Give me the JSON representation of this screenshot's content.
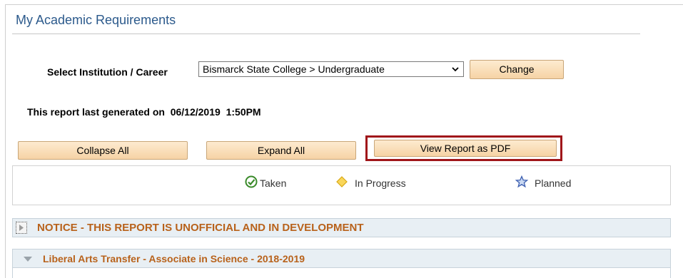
{
  "page": {
    "title": "My Academic Requirements"
  },
  "selector": {
    "label": "Select Institution / Career",
    "selected_value": "Bismarck State College > Undergraduate",
    "change_label": "Change"
  },
  "report": {
    "generated_label": "This report last generated on",
    "generated_date": "06/12/2019",
    "generated_time": "1:50PM"
  },
  "actions": {
    "collapse_label": "Collapse All",
    "expand_label": "Expand All",
    "pdf_label": "View Report as PDF",
    "highlight_color": "#a0161a"
  },
  "legend": {
    "taken": {
      "label": "Taken",
      "icon": "check-circle-icon",
      "color": "#3a8a2a"
    },
    "in_progress": {
      "label": "In Progress",
      "icon": "diamond-icon",
      "color": "#f2c230"
    },
    "planned": {
      "label": "Planned",
      "icon": "star-icon",
      "color": "#3d5fb0"
    }
  },
  "sections": [
    {
      "title": "NOTICE - THIS REPORT IS UNOFFICIAL AND IN DEVELOPMENT",
      "state": "collapsed",
      "icon": "expand-arrow-icon"
    },
    {
      "title": "Liberal Arts Transfer - Associate in Science - 2018-2019",
      "state": "expanded",
      "icon": "collapse-arrow-icon"
    }
  ],
  "colors": {
    "title": "#2c5a8c",
    "section_title": "#b8621b",
    "section_bg": "#e8eff4"
  }
}
